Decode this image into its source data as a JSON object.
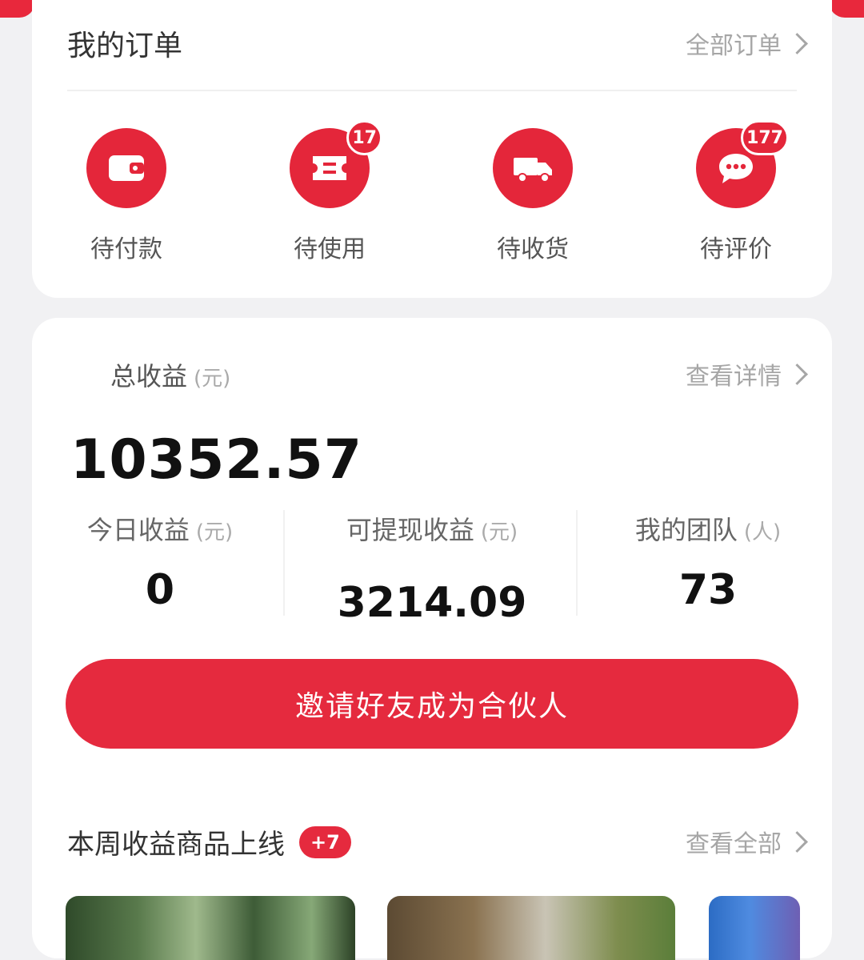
{
  "orders": {
    "title": "我的订单",
    "all_link": "全部订单",
    "items": [
      {
        "label": "待付款",
        "icon": "wallet-icon"
      },
      {
        "label": "待使用",
        "icon": "ticket-icon",
        "badge": "17"
      },
      {
        "label": "待收货",
        "icon": "truck-icon"
      },
      {
        "label": "待评价",
        "icon": "chat-bubble-icon",
        "badge": "177"
      }
    ]
  },
  "earnings": {
    "total_label": "总收益",
    "total_unit": "(元)",
    "details_link": "查看详情",
    "total_value": "10352.57",
    "stats": [
      {
        "label": "今日收益",
        "unit": "(元)",
        "value": "0"
      },
      {
        "label": "可提现收益",
        "unit": "(元)",
        "value": "3214.09"
      },
      {
        "label": "我的团队",
        "unit": "(人)",
        "value": "73"
      }
    ],
    "invite_button": "邀请好友成为合伙人"
  },
  "weekly": {
    "title": "本周收益商品上线",
    "badge": "+7",
    "view_all": "查看全部"
  },
  "colors": {
    "accent": "#e4263a",
    "background": "#f1f1f3"
  }
}
